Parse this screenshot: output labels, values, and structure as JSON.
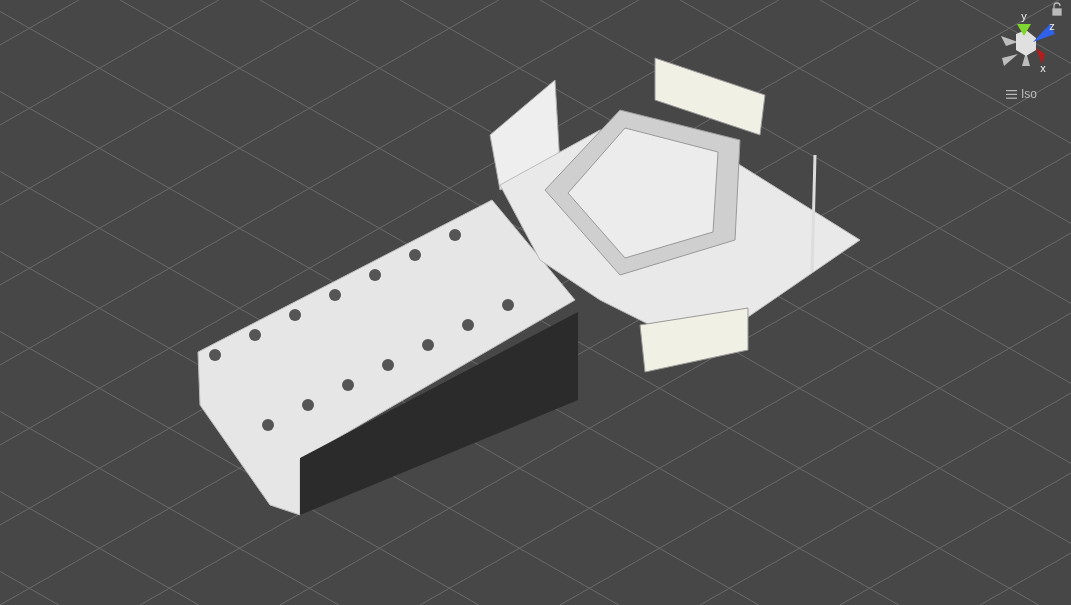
{
  "scene_view": {
    "gizmo": {
      "axes": [
        {
          "label": "y",
          "color": "#7fd62e"
        },
        {
          "label": "z",
          "color": "#2f62e8"
        },
        {
          "label": "x",
          "color": "#b31d1d"
        }
      ]
    },
    "projection": {
      "label": "Iso"
    }
  }
}
